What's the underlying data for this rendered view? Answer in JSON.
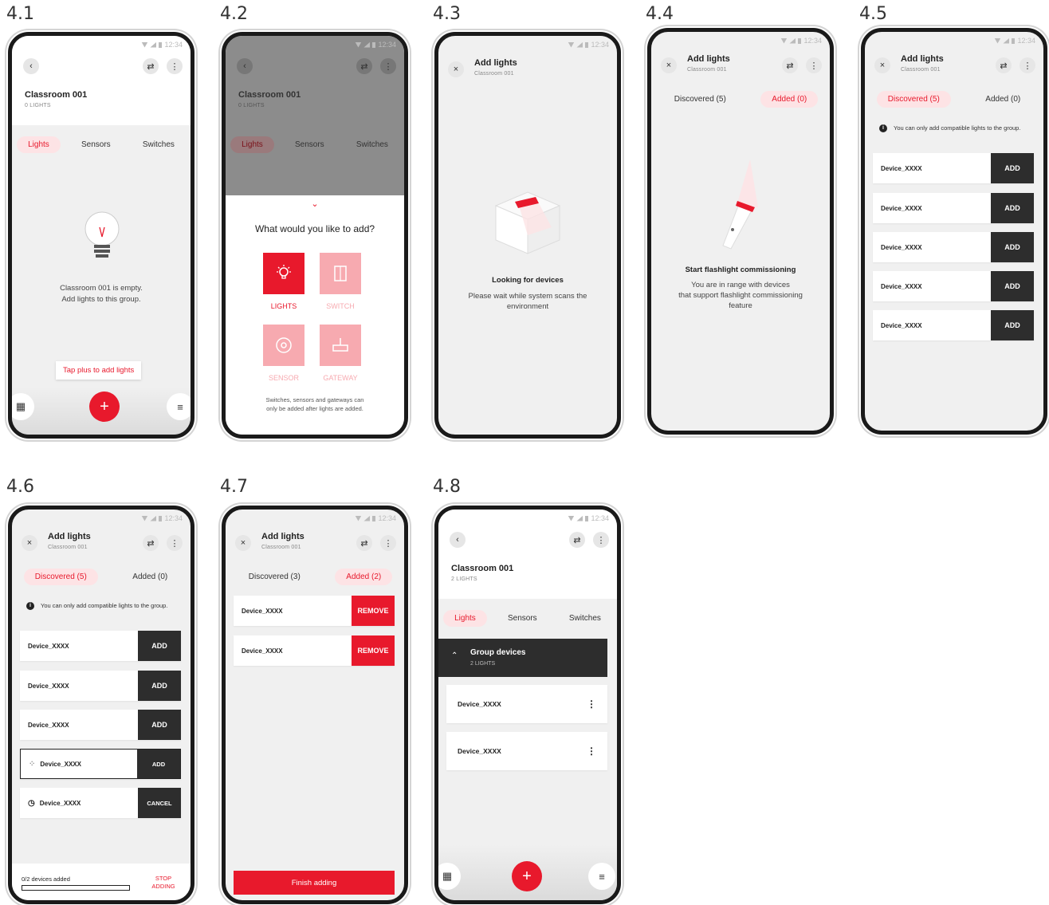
{
  "captions": [
    "4.1",
    "4.2",
    "4.3",
    "4.4",
    "4.5",
    "4.6",
    "4.7",
    "4.8"
  ],
  "status_time": "12:34",
  "colors": {
    "accent": "#e8192c",
    "accent_light": "#fde3e5",
    "dark": "#2d2d2d"
  },
  "s41": {
    "title": "Classroom 001",
    "sub": "0 LIGHTS",
    "tabs": [
      "Lights",
      "Sensors",
      "Switches"
    ],
    "empty_line1": "Classroom 001 is empty.",
    "empty_line2": "Add lights to this group.",
    "tooltip": "Tap plus to add lights",
    "fab": "+"
  },
  "s42": {
    "title": "Classroom 001",
    "sub": "0 LIGHTS",
    "tabs": [
      "Lights",
      "Sensors",
      "Switches"
    ],
    "question": "What would you like to add?",
    "options": [
      "LIGHTS",
      "SWITCH",
      "SENSOR",
      "GATEWAY"
    ],
    "note1": "Switches, sensors and gateways can",
    "note2": "only be added after lights are added."
  },
  "s43": {
    "title": "Add lights",
    "sub": "Classroom 001",
    "heading": "Looking for devices",
    "line1": "Please wait while system scans the",
    "line2": "environment"
  },
  "s44": {
    "title": "Add lights",
    "sub": "Classroom 001",
    "tab_discovered": "Discovered (5)",
    "tab_added": "Added (0)",
    "heading": "Start flashlight commissioning",
    "line1": "You are in range with devices",
    "line2": "that support flashlight commissioning",
    "line3": "feature"
  },
  "s45": {
    "title": "Add lights",
    "sub": "Classroom 001",
    "tab_discovered": "Discovered (5)",
    "tab_added": "Added (0)",
    "info": "You can only add compatible lights to the group.",
    "devices": [
      "Device_XXXX",
      "Device_XXXX",
      "Device_XXXX",
      "Device_XXXX",
      "Device_XXXX"
    ],
    "action": "ADD"
  },
  "s46": {
    "title": "Add lights",
    "sub": "Classroom 001",
    "tab_discovered": "Discovered (5)",
    "tab_added": "Added (0)",
    "info": "You can only add compatible lights to the group.",
    "devices": [
      {
        "name": "Device_XXXX",
        "action": "ADD"
      },
      {
        "name": "Device_XXXX",
        "action": "ADD"
      },
      {
        "name": "Device_XXXX",
        "action": "ADD"
      },
      {
        "name": "Device_XXXX",
        "action": "ADD"
      },
      {
        "name": "Device_XXXX",
        "action": "CANCEL"
      }
    ],
    "progress_label": "0/2 devices added",
    "progress": 0,
    "stop_line1": "STOP",
    "stop_line2": "ADDING"
  },
  "s47": {
    "title": "Add lights",
    "sub": "Classroom 001",
    "tab_discovered": "Discovered (3)",
    "tab_added": "Added (2)",
    "devices": [
      "Device_XXXX",
      "Device_XXXX"
    ],
    "action": "REMOVE",
    "finish": "Finish adding"
  },
  "s48": {
    "title": "Classroom 001",
    "sub": "2 LIGHTS",
    "tabs": [
      "Lights",
      "Sensors",
      "Switches"
    ],
    "group_title": "Group devices",
    "group_sub": "2 LIGHTS",
    "devices": [
      "Device_XXXX",
      "Device_XXXX"
    ],
    "fab": "+"
  }
}
